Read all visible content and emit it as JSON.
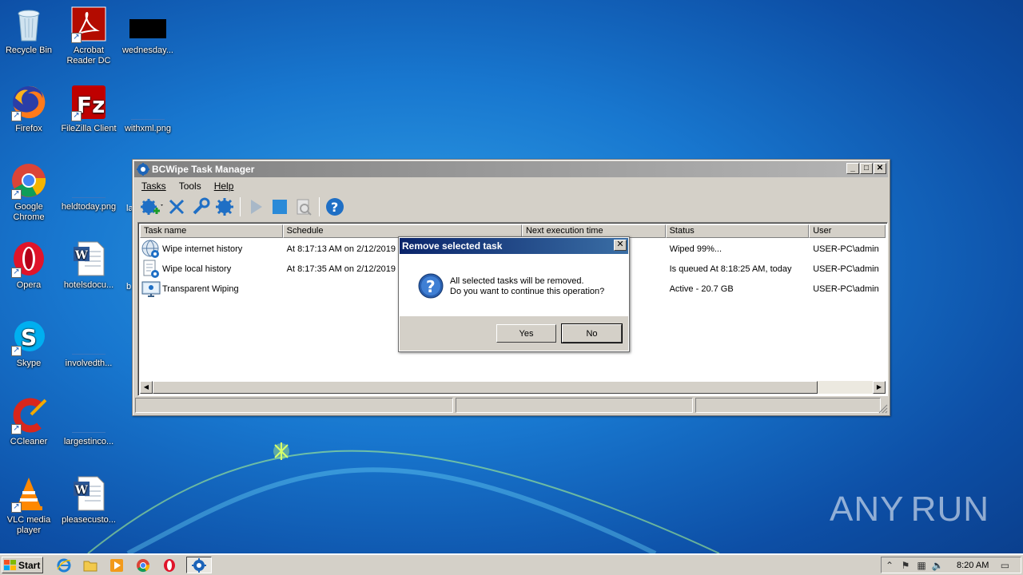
{
  "desktop": {
    "icons": [
      {
        "label": "Recycle Bin",
        "icon": "recycle-bin-icon"
      },
      {
        "label": "Acrobat Reader DC",
        "icon": "acrobat-icon"
      },
      {
        "label": "wednesday...",
        "icon": "image-file-icon"
      },
      {
        "label": "Firefox",
        "icon": "firefox-icon"
      },
      {
        "label": "FileZilla Client",
        "icon": "filezilla-icon"
      },
      {
        "label": "withxml.png",
        "icon": "image-file-icon"
      },
      {
        "label": "Google Chrome",
        "icon": "chrome-icon"
      },
      {
        "label": "heldtoday.png",
        "icon": "image-file-icon"
      },
      {
        "label": "Opera",
        "icon": "opera-icon"
      },
      {
        "label": "hotelsdocu...",
        "icon": "word-doc-icon"
      },
      {
        "label": "Skype",
        "icon": "skype-icon"
      },
      {
        "label": "involvedth...",
        "icon": "image-file-icon"
      },
      {
        "label": "CCleaner",
        "icon": "ccleaner-icon"
      },
      {
        "label": "largestinco...",
        "icon": "image-file-icon"
      },
      {
        "label": "VLC media player",
        "icon": "vlc-icon"
      },
      {
        "label": "pleasecusto...",
        "icon": "word-doc-icon"
      }
    ],
    "partial_labels": [
      "la",
      "b"
    ]
  },
  "window": {
    "title": "BCWipe Task Manager",
    "menu": [
      {
        "label": "Tasks",
        "accel": "T",
        "rest": "asks"
      },
      {
        "label": "Tools",
        "accel": "",
        "rest": "Tools"
      },
      {
        "label": "Help",
        "accel": "H",
        "rest": "elp"
      }
    ],
    "toolbar": [
      "new-task",
      "delete-task",
      "edit-task",
      "task-properties",
      "run-task",
      "stop-task",
      "view-log",
      "help"
    ],
    "columns": [
      "Task name",
      "Schedule",
      "Next execution time",
      "Status",
      "User"
    ],
    "rows": [
      {
        "name": "Wipe internet history",
        "schedule": "At 8:17:13 AM on 2/12/2019",
        "next": "",
        "status": "Wiped 99%...",
        "user": "USER-PC\\admin"
      },
      {
        "name": "Wipe local history",
        "schedule": "At 8:17:35 AM on 2/12/2019",
        "next": "",
        "status": "Is queued At 8:18:25 AM, today",
        "user": "USER-PC\\admin"
      },
      {
        "name": "Transparent Wiping",
        "schedule": "",
        "next": "",
        "status": "Active - 20.7 GB",
        "user": "USER-PC\\admin"
      }
    ]
  },
  "dialog": {
    "title": "Remove selected task",
    "line1": "All selected tasks will be removed.",
    "line2": "Do you want to continue this operation?",
    "yes": "Yes",
    "no": "No"
  },
  "taskbar": {
    "start": "Start",
    "clock": "8:20 AM"
  },
  "watermark": {
    "left": "ANY",
    "right": "RUN"
  },
  "colors": {
    "dialog_title": "#0a246a",
    "window_title_inactive": "#808080",
    "desktop": "#1877cf"
  }
}
